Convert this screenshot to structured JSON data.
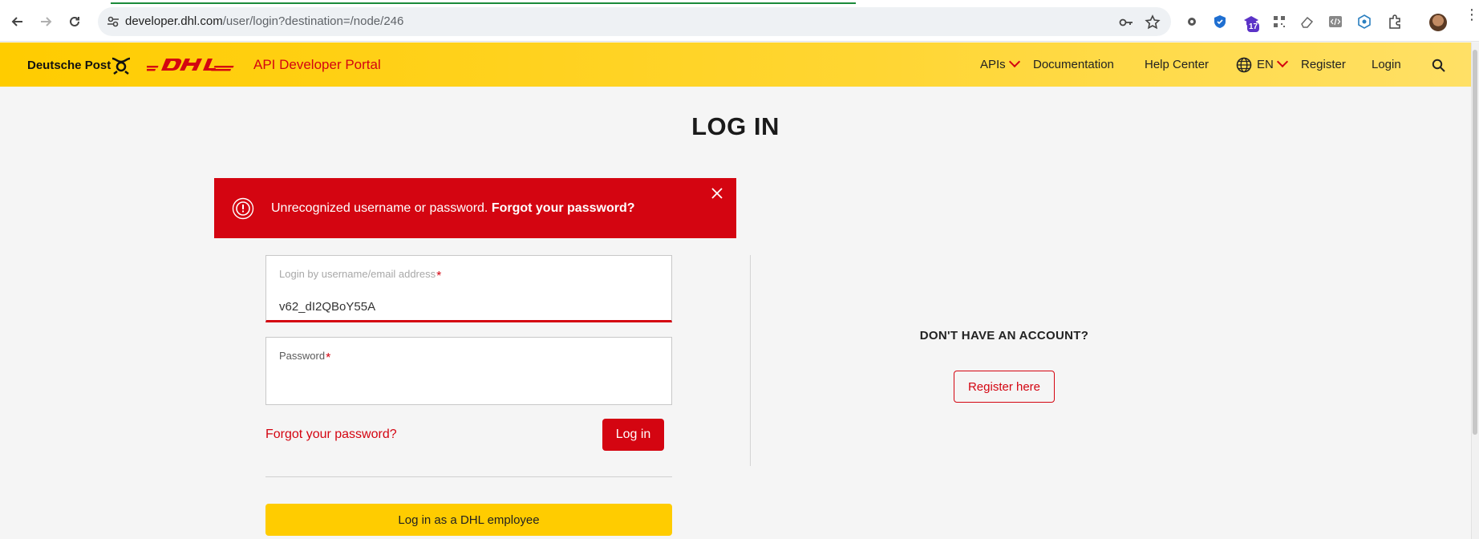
{
  "browser": {
    "url_host": "developer.dhl.com",
    "url_path": "/user/login?destination=/node/246",
    "extension_badge": "17"
  },
  "header": {
    "deutsche_post": "Deutsche Post",
    "portal_title": "API Developer Portal",
    "nav": {
      "apis": "APIs",
      "documentation": "Documentation",
      "help_center": "Help Center",
      "language": "EN",
      "register": "Register",
      "login": "Login"
    }
  },
  "page": {
    "title": "LOG IN"
  },
  "alert": {
    "message": "Unrecognized username or password.",
    "link": "Forgot your password?"
  },
  "form": {
    "username_label": "Login by username/email address",
    "username_value": "v62_dI2QBoY55A",
    "password_label": "Password",
    "required_mark": "*",
    "forgot_link": "Forgot your password?",
    "login_button": "Log in",
    "employee_button": "Log in as a DHL employee"
  },
  "signup": {
    "heading": "DON'T HAVE AN ACCOUNT?",
    "button": "Register here"
  },
  "colors": {
    "dhl_red": "#d40511",
    "dhl_yellow": "#ffcc00"
  }
}
